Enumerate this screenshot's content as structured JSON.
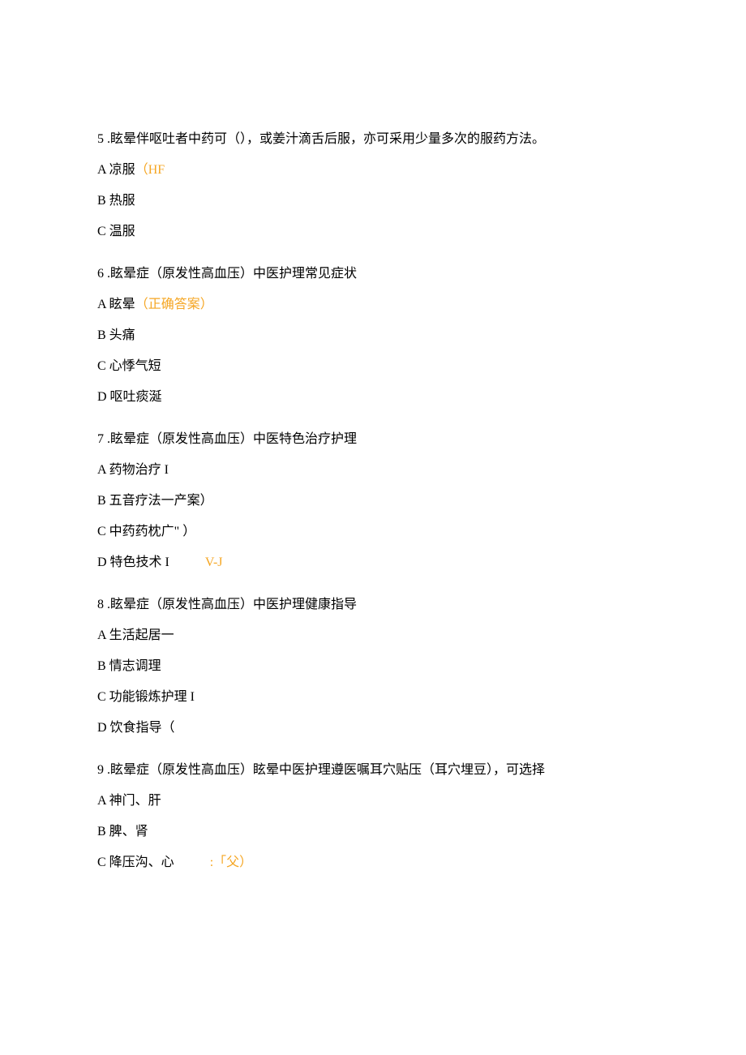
{
  "questions": [
    {
      "num": "5",
      "stem": " .眩晕伴呕吐者中药可（），或姜汁滴舌后服，亦可采用少量多次的服药方法。",
      "options": [
        {
          "label": "A 凉服",
          "note": "（HF"
        },
        {
          "label": "B 热服",
          "note": ""
        },
        {
          "label": "C 温服",
          "note": ""
        }
      ]
    },
    {
      "num": "6",
      "stem": " .眩晕症（原发性高血压）中医护理常见症状",
      "options": [
        {
          "label": "A 眩晕",
          "note": "（正确答案）"
        },
        {
          "label": "B 头痛",
          "note": ""
        },
        {
          "label": "C 心悸气短",
          "note": ""
        },
        {
          "label": "D 呕吐痰涎",
          "note": ""
        }
      ]
    },
    {
      "num": "7",
      "stem": " .眩晕症（原发性高血压）中医特色治疗护理",
      "options": [
        {
          "label": "A 药物治疗 I",
          "note": ""
        },
        {
          "label": "B 五音疗法一产案）",
          "note": ""
        },
        {
          "label": "C 中药药枕广\" ）",
          "note": ""
        },
        {
          "label": "D 特色技术 I",
          "note": "V-J",
          "gap": true
        }
      ]
    },
    {
      "num": "8",
      "stem": " .眩晕症（原发性高血压）中医护理健康指导",
      "options": [
        {
          "label": "A 生活起居一",
          "note": ""
        },
        {
          "label": "B 情志调理",
          "note": ""
        },
        {
          "label": "C 功能锻炼护理 I",
          "note": ""
        },
        {
          "label": "D 饮食指导（",
          "note": ""
        }
      ]
    },
    {
      "num": "9",
      "stem": " .眩晕症（原发性高血压）眩晕中医护理遵医嘱耳穴贴压（耳穴埋豆），可选择",
      "options": [
        {
          "label": "A 神门、肝",
          "note": ""
        },
        {
          "label": "B 脾、肾",
          "note": ""
        },
        {
          "label": "C 降压沟、心",
          "note": ":「父）",
          "gap": true
        }
      ]
    }
  ]
}
